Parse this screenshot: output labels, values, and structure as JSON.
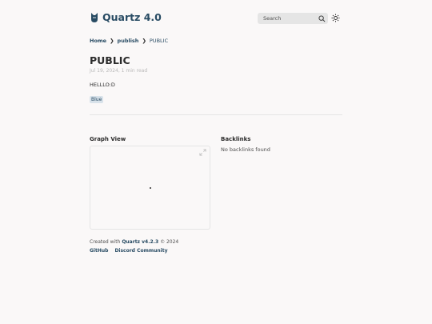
{
  "header": {
    "site_title": "Quartz 4.0",
    "search_label": "Search"
  },
  "breadcrumb": {
    "items": [
      "Home",
      "publish",
      "PUBLIC"
    ],
    "separator": "❯"
  },
  "article": {
    "title": "PUBLIC",
    "meta": "Jul 19, 2024, 1 min read",
    "body": "HELLLO:D",
    "tag": "Blue"
  },
  "graph": {
    "heading": "Graph View"
  },
  "backlinks": {
    "heading": "Backlinks",
    "empty_text": "No backlinks found"
  },
  "footer": {
    "created_prefix": "Created with",
    "quartz_version": "Quartz v4.2.3",
    "year_text": "© 2024",
    "links": [
      "GitHub",
      "Discord Community"
    ]
  },
  "colors": {
    "accent": "#284b63",
    "text": "#2b2b2b",
    "muted": "#b8b8b8",
    "background": "#faf8f8"
  }
}
